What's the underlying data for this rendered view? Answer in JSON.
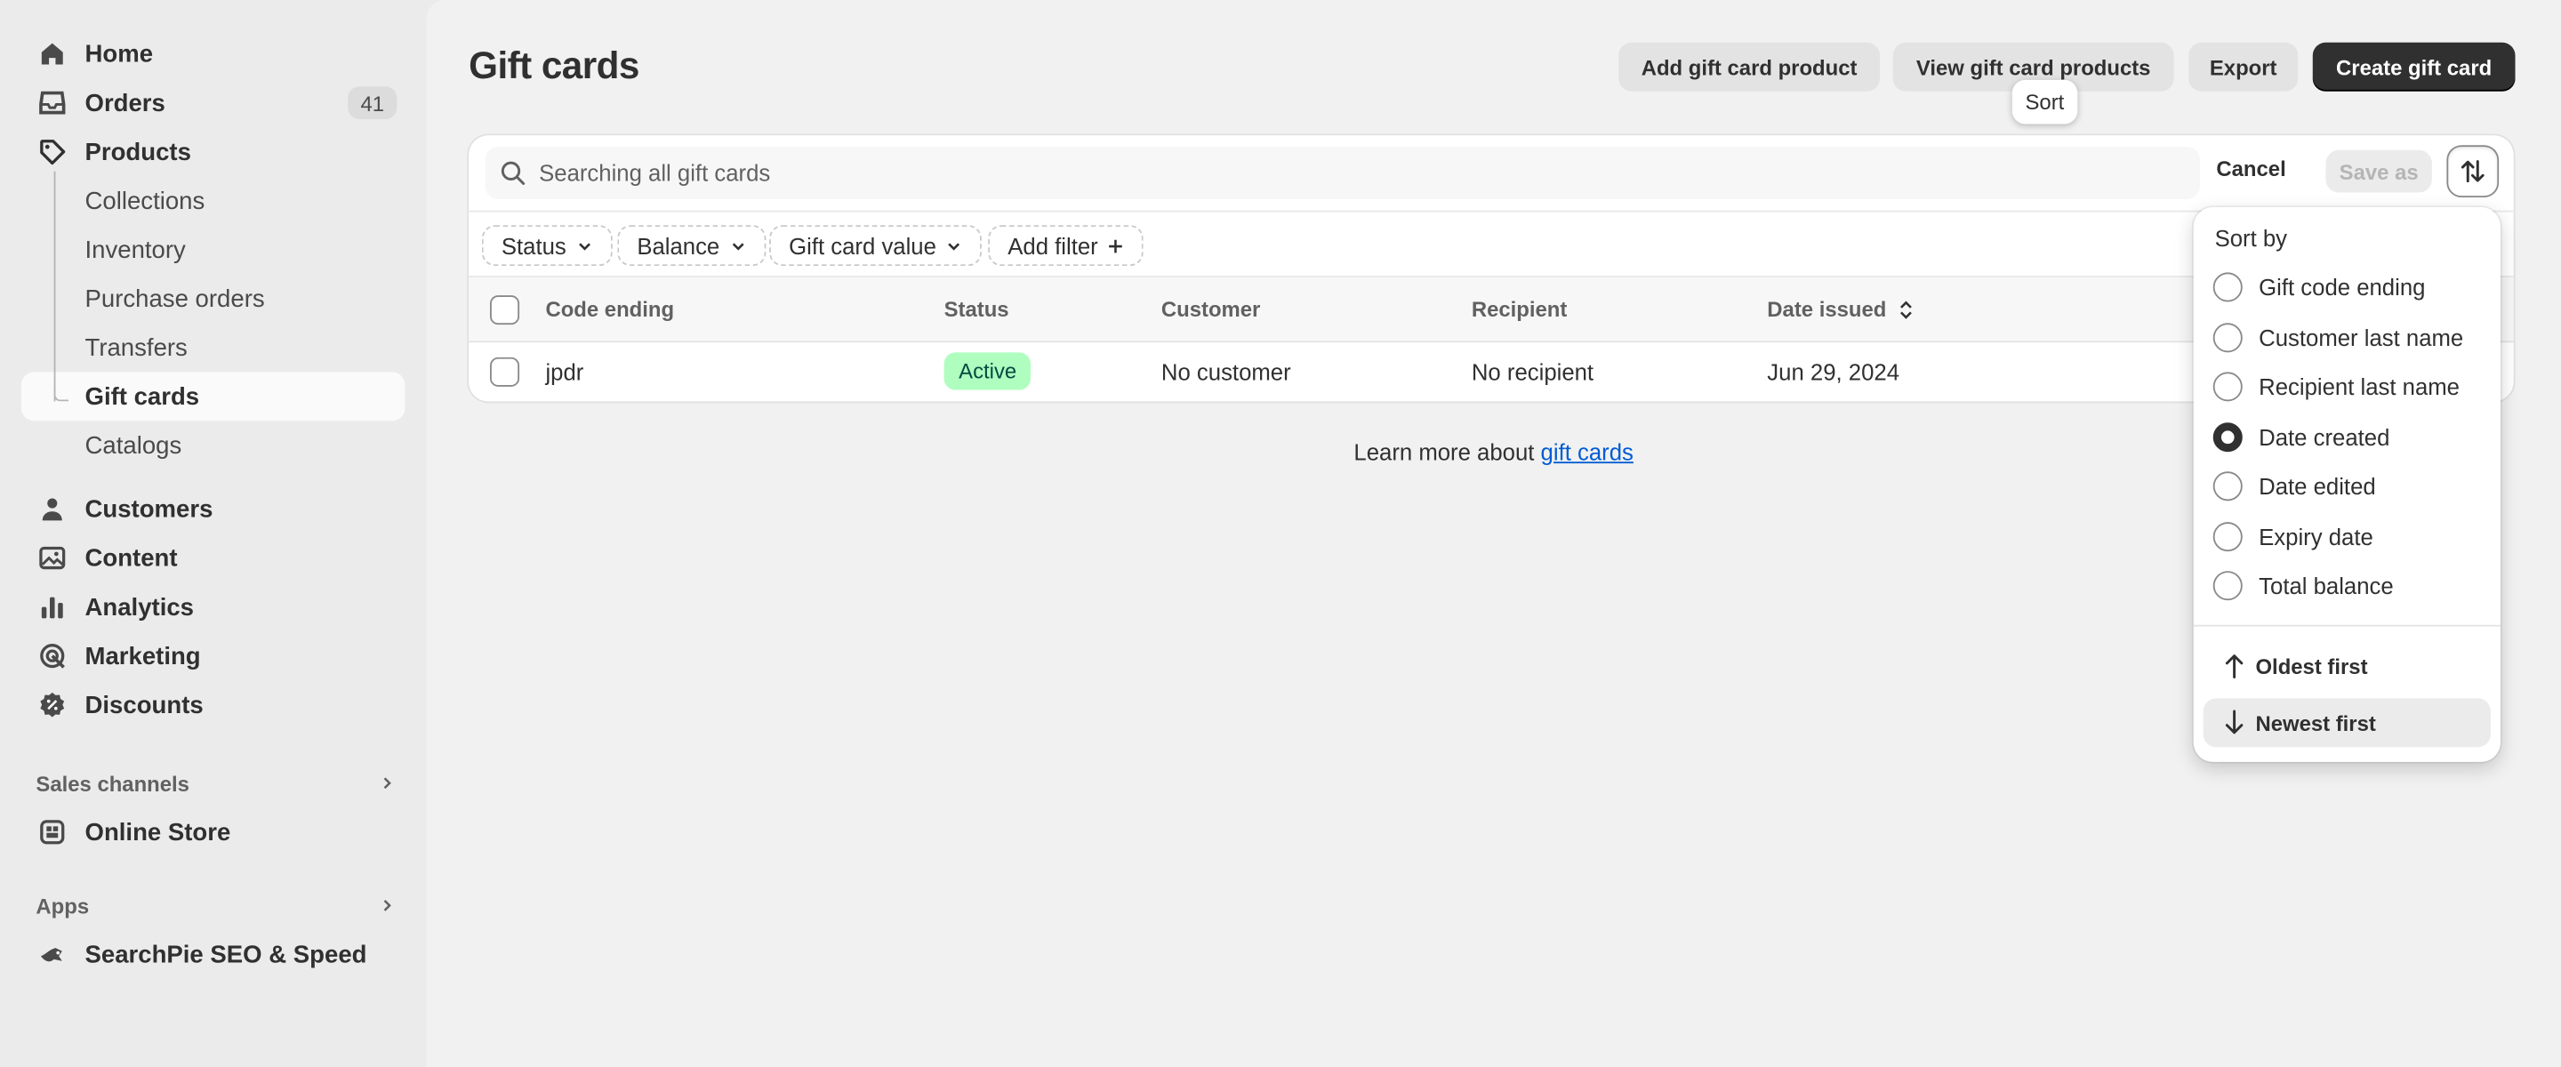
{
  "sidebar": {
    "items": [
      {
        "label": "Home",
        "icon": "home-icon"
      },
      {
        "label": "Orders",
        "icon": "inbox-icon",
        "badge": "41"
      },
      {
        "label": "Products",
        "icon": "tag-icon"
      },
      {
        "label": "Collections"
      },
      {
        "label": "Inventory"
      },
      {
        "label": "Purchase orders"
      },
      {
        "label": "Transfers"
      },
      {
        "label": "Gift cards"
      },
      {
        "label": "Catalogs"
      },
      {
        "label": "Customers",
        "icon": "person-icon"
      },
      {
        "label": "Content",
        "icon": "image-icon"
      },
      {
        "label": "Analytics",
        "icon": "bar-chart-icon"
      },
      {
        "label": "Marketing",
        "icon": "target-icon"
      },
      {
        "label": "Discounts",
        "icon": "discount-icon"
      }
    ],
    "sales_channels": {
      "title": "Sales channels",
      "items": [
        {
          "label": "Online Store",
          "icon": "store-icon"
        }
      ]
    },
    "apps": {
      "title": "Apps",
      "items": [
        {
          "label": "SearchPie SEO & Speed",
          "icon": "searchpie-app-icon"
        }
      ]
    }
  },
  "header": {
    "title": "Gift cards",
    "actions": {
      "add_product": "Add gift card product",
      "view_products": "View gift card products",
      "export": "Export",
      "create": "Create gift card"
    },
    "tooltip": "Sort"
  },
  "search": {
    "placeholder": "Searching all gift cards",
    "cancel": "Cancel",
    "save_as": "Save as"
  },
  "filters": [
    "Status",
    "Balance",
    "Gift card value",
    "Add filter"
  ],
  "table": {
    "headers": [
      "Code ending",
      "Status",
      "Customer",
      "Recipient",
      "Date issued"
    ],
    "rows": [
      {
        "code": "jpdr",
        "status": "Active",
        "customer": "No customer",
        "recipient": "No recipient",
        "date": "Jun 29, 2024"
      }
    ]
  },
  "footer": {
    "text": "Learn more about ",
    "link": "gift cards"
  },
  "sort_popover": {
    "title": "Sort by",
    "options": [
      "Gift code ending",
      "Customer last name",
      "Recipient last name",
      "Date created",
      "Date edited",
      "Expiry date",
      "Total balance"
    ],
    "selected": "Date created",
    "directions": [
      "Oldest first",
      "Newest first"
    ],
    "selected_direction": "Newest first"
  },
  "colors": {
    "primary_button": "#303030",
    "status_active_bg": "#affebf",
    "status_active_text": "#014b40",
    "link": "#005bd3"
  }
}
